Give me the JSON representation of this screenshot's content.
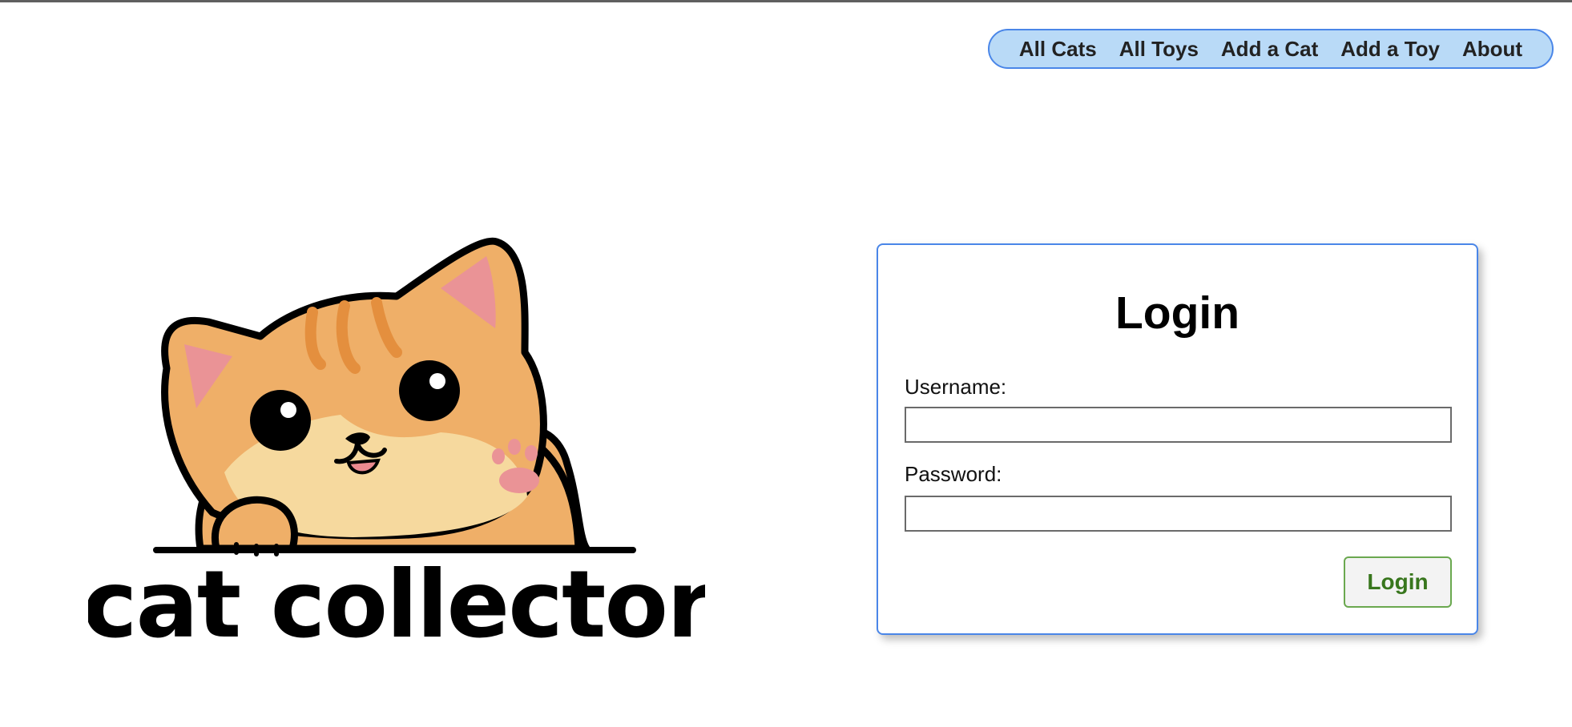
{
  "nav": {
    "items": [
      {
        "label": "All Cats"
      },
      {
        "label": "All Toys"
      },
      {
        "label": "Add a Cat"
      },
      {
        "label": "Add a Toy"
      },
      {
        "label": "About"
      }
    ]
  },
  "logo": {
    "text": "cat collector",
    "icon": "waving-kitten-icon"
  },
  "login": {
    "title": "Login",
    "username_label": "Username:",
    "username_value": "",
    "password_label": "Password:",
    "password_value": "",
    "submit_label": "Login"
  },
  "colors": {
    "nav_background": "#b9daf7",
    "nav_border": "#4a86e8",
    "card_border": "#4a86e8",
    "button_border": "#6aa84f",
    "button_text": "#38761d",
    "cat_orange": "#efaf68",
    "cat_cream": "#f6d99e",
    "cat_stripe": "#e48f3e",
    "ear_pink": "#ea9396"
  }
}
